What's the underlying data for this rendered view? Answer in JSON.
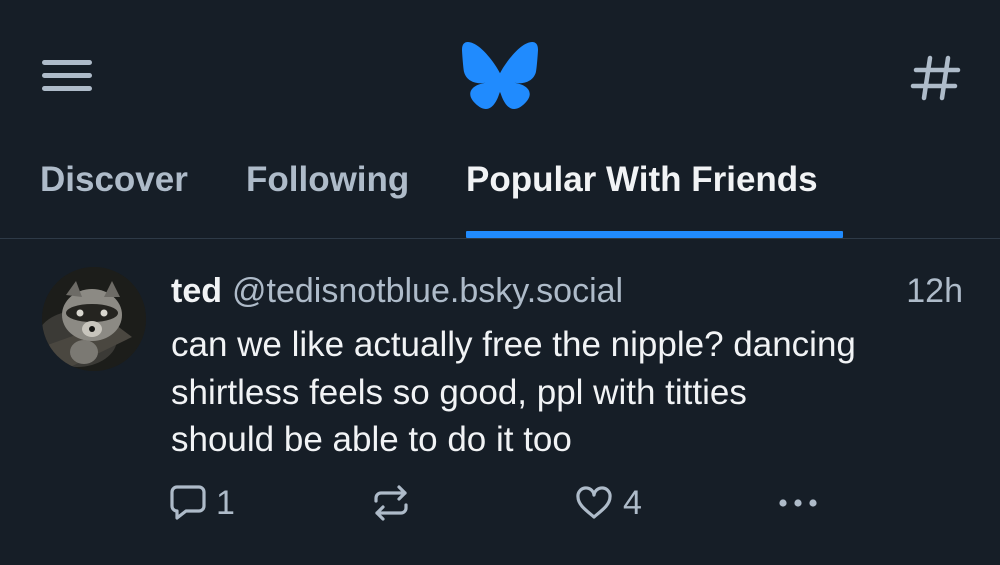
{
  "app": {
    "brand_color": "#208bfe",
    "background": "#161e27"
  },
  "header": {
    "menu_icon": "hamburger-menu-icon",
    "logo_icon": "butterfly-logo-icon",
    "feeds_icon": "hashtag-icon"
  },
  "tabs": [
    {
      "label": "Discover",
      "active": false
    },
    {
      "label": "Following",
      "active": false
    },
    {
      "label": "Popular With Friends",
      "active": true
    }
  ],
  "post": {
    "author_name": "ted",
    "author_handle": "@tedisnotblue.bsky.social",
    "timestamp": "12h",
    "text_lines": [
      "can we like actually free the nipple? dancing",
      "shirtless feels so good, ppl with titties",
      "should be able to do it too"
    ],
    "actions": {
      "reply_icon": "speech-bubble-icon",
      "reply_count": "1",
      "repost_icon": "repost-arrows-icon",
      "like_icon": "heart-icon",
      "like_count": "4",
      "more_icon": "ellipsis-icon"
    }
  }
}
